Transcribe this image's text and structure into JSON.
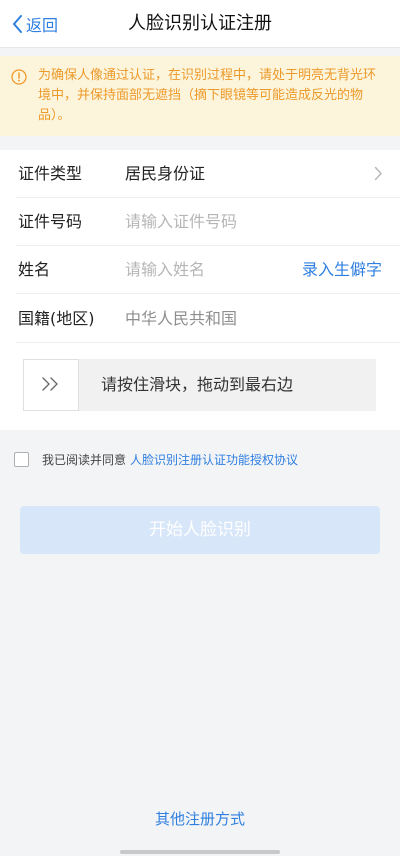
{
  "navbar": {
    "back_label": "返回",
    "title": "人脸识别认证注册"
  },
  "notice": {
    "icon": "info-circle-icon",
    "text": "为确保人像通过认证，在识别过程中，请处于明亮无背光环境中，并保持面部无遮挡（摘下眼镜等可能造成反光的物品）。",
    "color": "#ec9a2a",
    "background": "#fdf4dc"
  },
  "form": {
    "id_type": {
      "label": "证件类型",
      "value": "居民身份证"
    },
    "id_number": {
      "label": "证件号码",
      "placeholder": "请输入证件号码"
    },
    "name": {
      "label": "姓名",
      "placeholder": "请输入姓名",
      "action": "录入生僻字"
    },
    "nationality": {
      "label": "国籍(地区)",
      "value": "中华人民共和国"
    }
  },
  "slider": {
    "text": "请按住滑块，拖动到最右边",
    "handle_icon": "double-chevron-right-icon"
  },
  "agreement": {
    "prefix": "我已阅读并同意",
    "link": "人脸识别注册认证功能授权协议",
    "checked": false
  },
  "start_button": {
    "label": "开始人脸识别",
    "disabled": true
  },
  "other_methods": {
    "label": "其他注册方式"
  },
  "colors": {
    "accent": "#2f7fe0",
    "warning_text": "#ec9a2a",
    "disabled_button": "#d7e6f9"
  }
}
